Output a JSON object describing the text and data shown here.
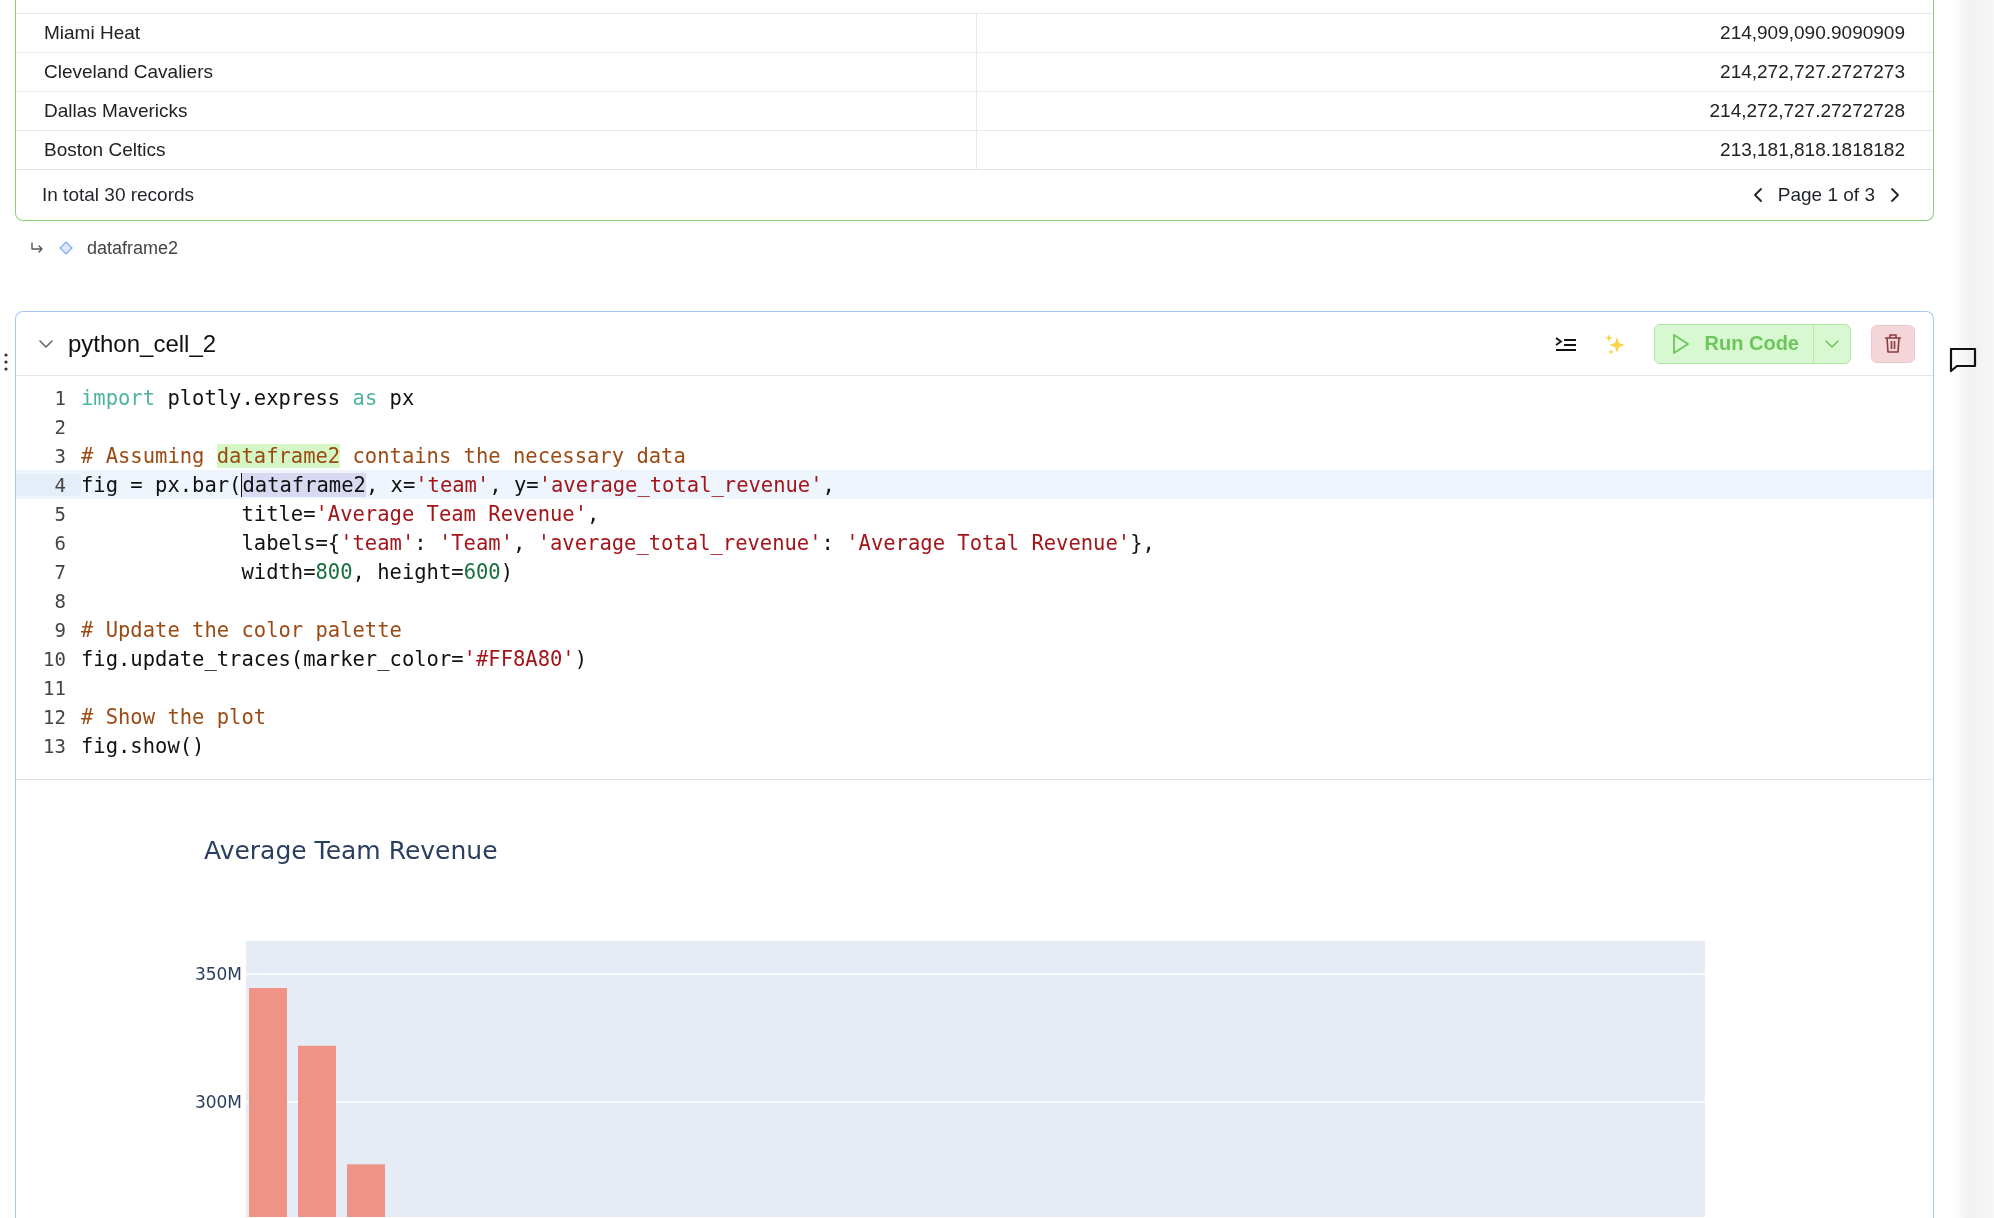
{
  "table": {
    "rows": [
      {
        "cells": [
          "Miami Heat",
          "214,909,090.9090909"
        ]
      },
      {
        "cells": [
          "Cleveland Cavaliers",
          "214,272,727.2727273"
        ]
      },
      {
        "cells": [
          "Dallas Mavericks",
          "214,272,727.27272728"
        ]
      },
      {
        "cells": [
          "Boston Celtics",
          "213,181,818.1818182"
        ]
      }
    ],
    "footer": {
      "total": "In total 30 records",
      "page": "Page 1 of 3"
    }
  },
  "output_link": {
    "label": "dataframe2"
  },
  "cell": {
    "title": "python_cell_2",
    "expanded": true,
    "run_button": "Run Code",
    "code_lines": [
      {
        "number": "1",
        "selected": false,
        "tokens": [
          {
            "kind": "keyword",
            "text": "import"
          },
          {
            "kind": "plain",
            "text": " plotly.express "
          },
          {
            "kind": "keyword",
            "text": "as"
          },
          {
            "kind": "plain",
            "text": " px"
          }
        ]
      },
      {
        "number": "2",
        "selected": false
      },
      {
        "number": "3",
        "selected": false,
        "tokens": [
          {
            "kind": "comment",
            "text": "# Assuming "
          },
          {
            "kind": "match",
            "text": "dataframe2"
          },
          {
            "kind": "comment",
            "text": " contains the necessary data"
          }
        ]
      },
      {
        "number": "4",
        "selected": true,
        "tokens": [
          {
            "kind": "plain",
            "text": "fig = px.bar("
          },
          {
            "kind": "selection",
            "text": "dataframe2"
          },
          {
            "kind": "plain",
            "text": ", x="
          },
          {
            "kind": "string",
            "text": "'team'"
          },
          {
            "kind": "plain",
            "text": ", y="
          },
          {
            "kind": "string",
            "text": "'average_total_revenue'"
          },
          {
            "kind": "plain",
            "text": ","
          }
        ]
      },
      {
        "number": "5",
        "selected": false,
        "tokens": [
          {
            "kind": "plain",
            "text": "             title="
          },
          {
            "kind": "string",
            "text": "'Average Team Revenue'"
          },
          {
            "kind": "plain",
            "text": ","
          }
        ]
      },
      {
        "number": "6",
        "selected": false,
        "tokens": [
          {
            "kind": "plain",
            "text": "             labels={"
          },
          {
            "kind": "string",
            "text": "'team'"
          },
          {
            "kind": "plain",
            "text": ": "
          },
          {
            "kind": "string",
            "text": "'Team'"
          },
          {
            "kind": "plain",
            "text": ", "
          },
          {
            "kind": "string",
            "text": "'average_total_revenue'"
          },
          {
            "kind": "plain",
            "text": ": "
          },
          {
            "kind": "string",
            "text": "'Average Total Revenue'"
          },
          {
            "kind": "plain",
            "text": "},"
          }
        ]
      },
      {
        "number": "7",
        "selected": false,
        "tokens": [
          {
            "kind": "plain",
            "text": "             width="
          },
          {
            "kind": "number",
            "text": "800"
          },
          {
            "kind": "plain",
            "text": ", height="
          },
          {
            "kind": "number",
            "text": "600"
          },
          {
            "kind": "plain",
            "text": ")"
          }
        ]
      },
      {
        "number": "8",
        "selected": false
      },
      {
        "number": "9",
        "selected": false,
        "tokens": [
          {
            "kind": "comment",
            "text": "# Update the color palette"
          }
        ]
      },
      {
        "number": "10",
        "selected": false,
        "tokens": [
          {
            "kind": "plain",
            "text": "fig.update_traces(marker_color="
          },
          {
            "kind": "string",
            "text": "'#FF8A80'"
          },
          {
            "kind": "plain",
            "text": ")"
          }
        ]
      },
      {
        "number": "11",
        "selected": false
      },
      {
        "number": "12",
        "selected": false,
        "tokens": [
          {
            "kind": "comment",
            "text": "# Show the plot"
          }
        ]
      },
      {
        "number": "13",
        "selected": false,
        "tokens": [
          {
            "kind": "plain",
            "text": "fig.show()"
          }
        ]
      }
    ],
    "output": {
      "chart_data": {
        "type": "bar",
        "title": "Average Team Revenue",
        "series": [
          {
            "color": "#ef9386",
            "values": [
              344600000,
              322000000,
              275600000
            ]
          }
        ],
        "ylim": [
          255000000,
          363000000
        ],
        "yticks": [
          {
            "value": 300000000,
            "label": "300M"
          },
          {
            "value": 350000000,
            "label": "350M"
          }
        ]
      }
    }
  }
}
